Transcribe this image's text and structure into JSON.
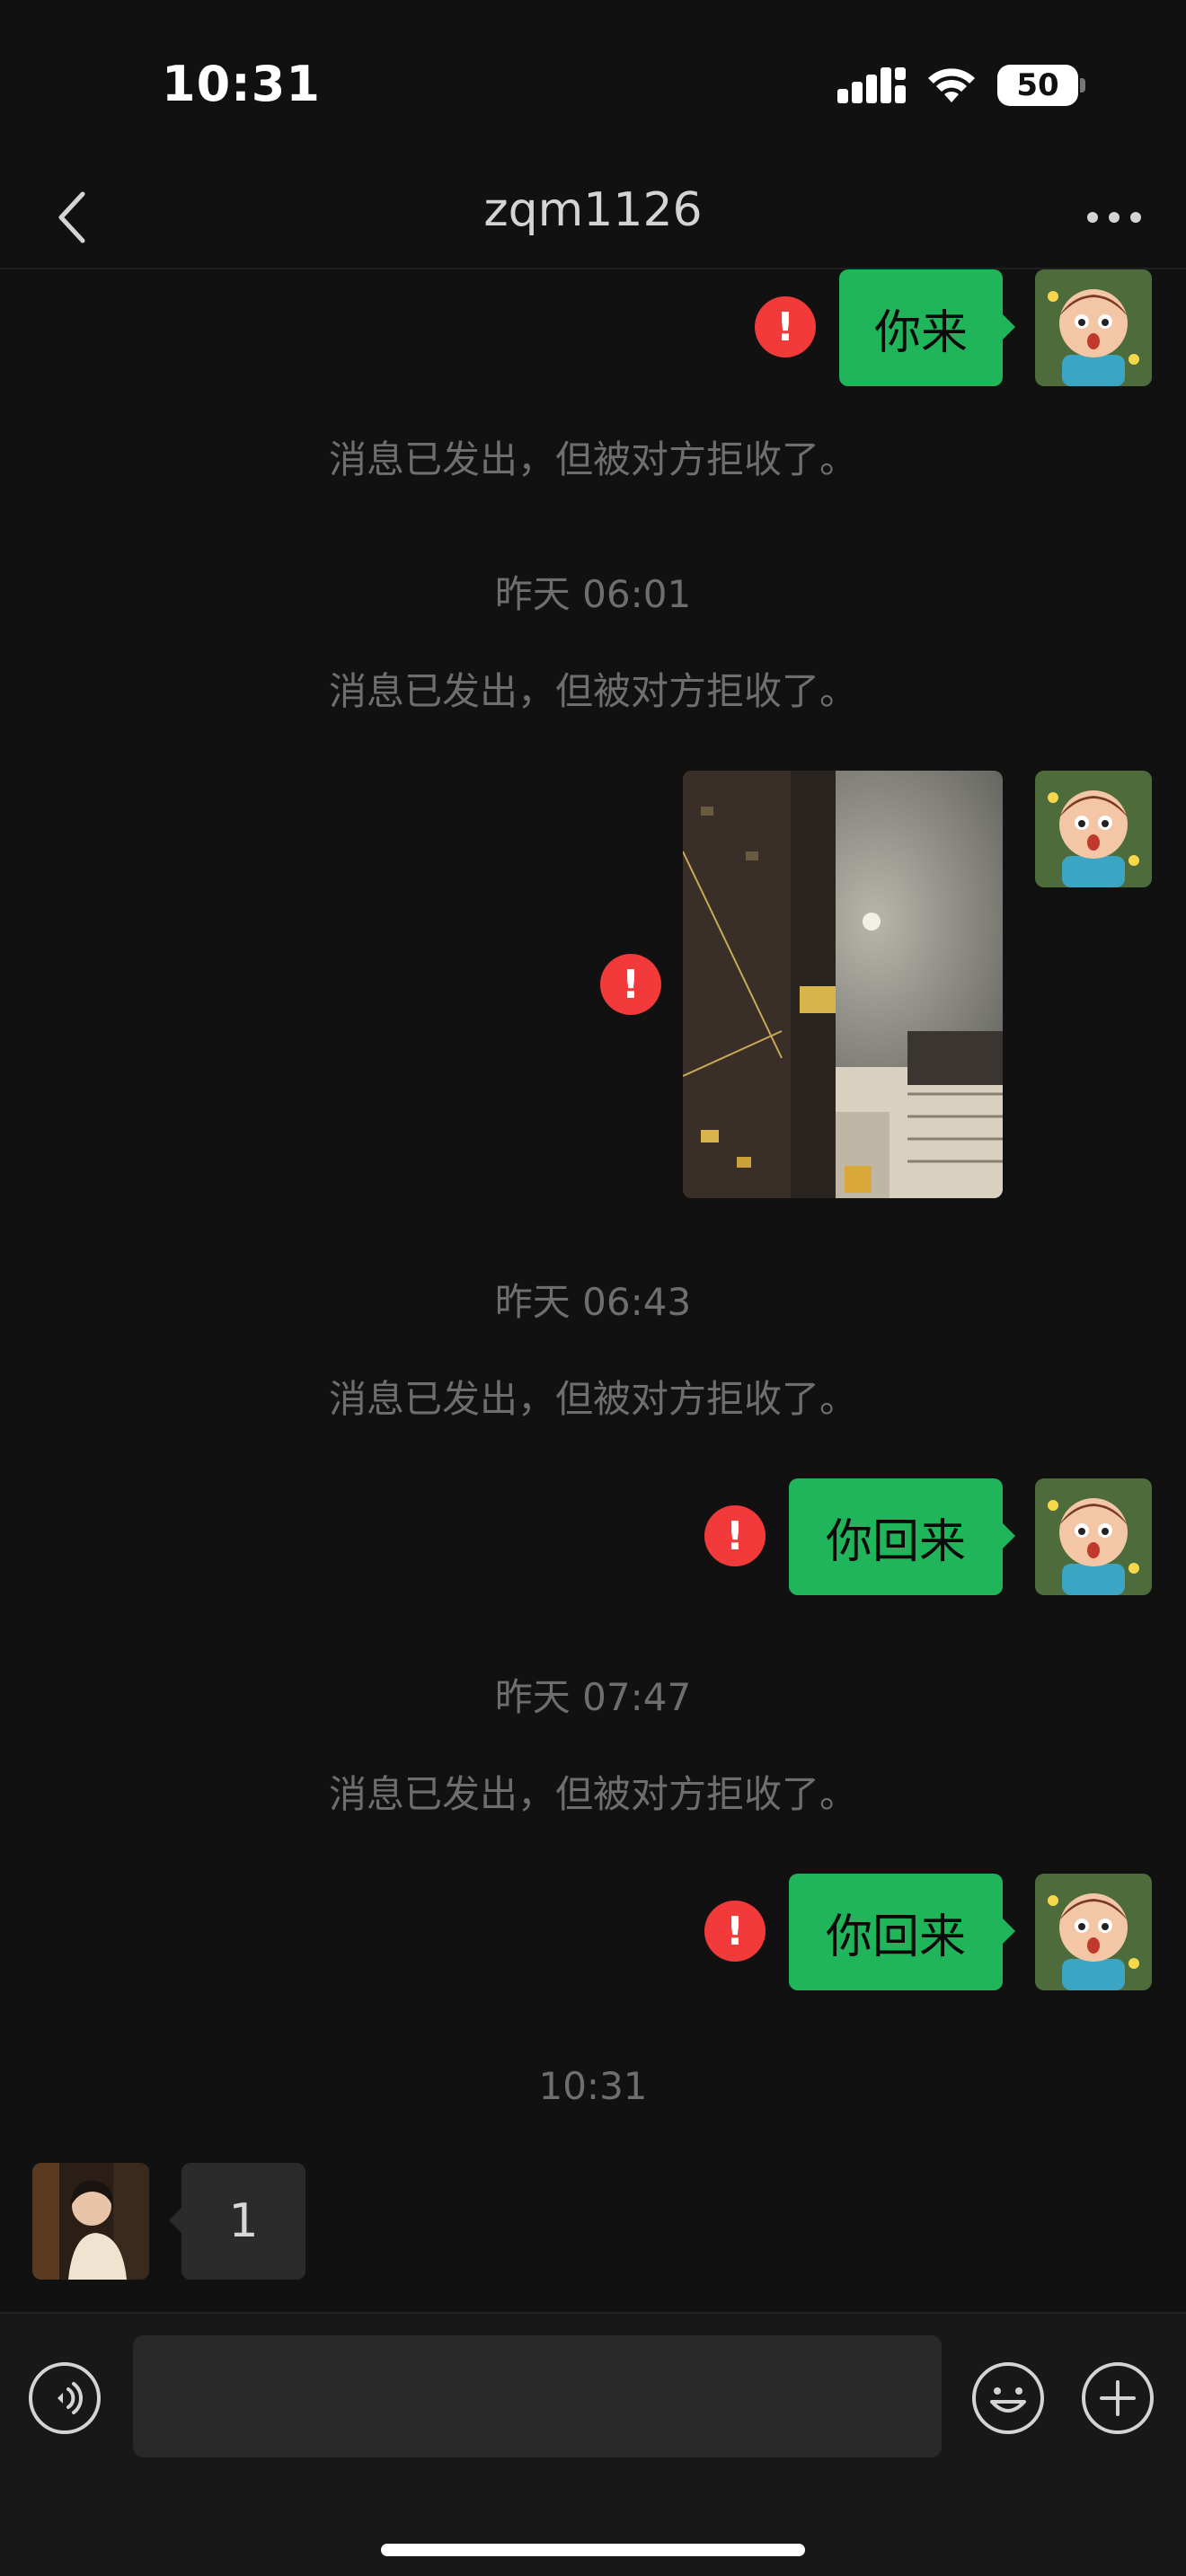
{
  "status_bar": {
    "time": "10:31",
    "battery": "50",
    "icons": [
      "cellular-icon",
      "wifi-icon",
      "battery-icon"
    ]
  },
  "nav": {
    "title": "zqm1126",
    "back_icon": "chevron-left-icon",
    "more_icon": "ellipsis-icon"
  },
  "messages": {
    "msg1_text": "你来",
    "notice_1": "消息已发出，但被对方拒收了。",
    "time_1": "昨天 06:01",
    "notice_2": "消息已发出，但被对方拒收了。",
    "time_2": "昨天 06:43",
    "notice_3": "消息已发出，但被对方拒收了。",
    "msg3_text": "你回来",
    "time_3": "昨天 07:47",
    "notice_4": "消息已发出，但被对方拒收了。",
    "msg4_text": "你回来",
    "time_4": "10:31",
    "incoming_text": "1",
    "error_mark": "!"
  },
  "input_bar": {
    "placeholder": "",
    "voice_icon": "voice-icon",
    "emoji_icon": "emoji-icon",
    "plus_icon": "plus-icon"
  },
  "colors": {
    "bubble_sent": "#20b55a",
    "error": "#f23a3a",
    "background": "#111111",
    "bubble_received": "#2b2b2b"
  }
}
